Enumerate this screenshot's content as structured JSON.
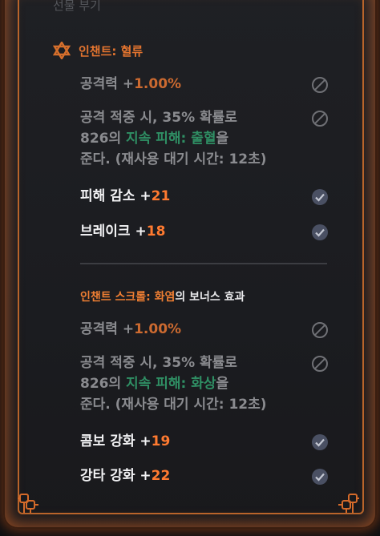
{
  "top_cut_label": "선물 부기",
  "section1": {
    "title": "인챈트: 혈류",
    "lines": [
      {
        "label": "공격력 +",
        "value": "1.00%",
        "state": "disabled"
      },
      {
        "text1": "공격 적중 시, 35% 확률로",
        "text2a": "826의 ",
        "text2b": "지속 피해: 출혈",
        "text2c": "을",
        "text3": "준다. (재사용 대기 시간: 12초)",
        "state": "disabled"
      },
      {
        "label": "피해 감소 +",
        "value": "21",
        "state": "active"
      },
      {
        "label": "브레이크 +",
        "value": "18",
        "state": "active"
      }
    ]
  },
  "section2": {
    "title_prefix": "인챈트 스크롤: ",
    "title_name": "화염",
    "title_suffix": "의 보너스 효과",
    "lines": [
      {
        "label": "공격력 +",
        "value": "1.00%",
        "state": "disabled"
      },
      {
        "text1": "공격 적중 시, 35% 확률로",
        "text2a": "826의 ",
        "text2b": "지속 피해: 화상",
        "text2c": "을",
        "text3": "준다. (재사용 대기 시간: 12초)",
        "state": "disabled"
      },
      {
        "label": "콤보 강화 +",
        "value": "19",
        "state": "active"
      },
      {
        "label": "강타 강화 +",
        "value": "22",
        "state": "active"
      }
    ]
  },
  "colors": {
    "accent_orange": "#f07f33",
    "effect_green": "#2f8f64",
    "frame_glow": "#e36e28"
  },
  "icons": {
    "disabled": "blocked-circle-icon",
    "active": "checkmark-circle-icon",
    "section": "star-of-david-icon"
  }
}
